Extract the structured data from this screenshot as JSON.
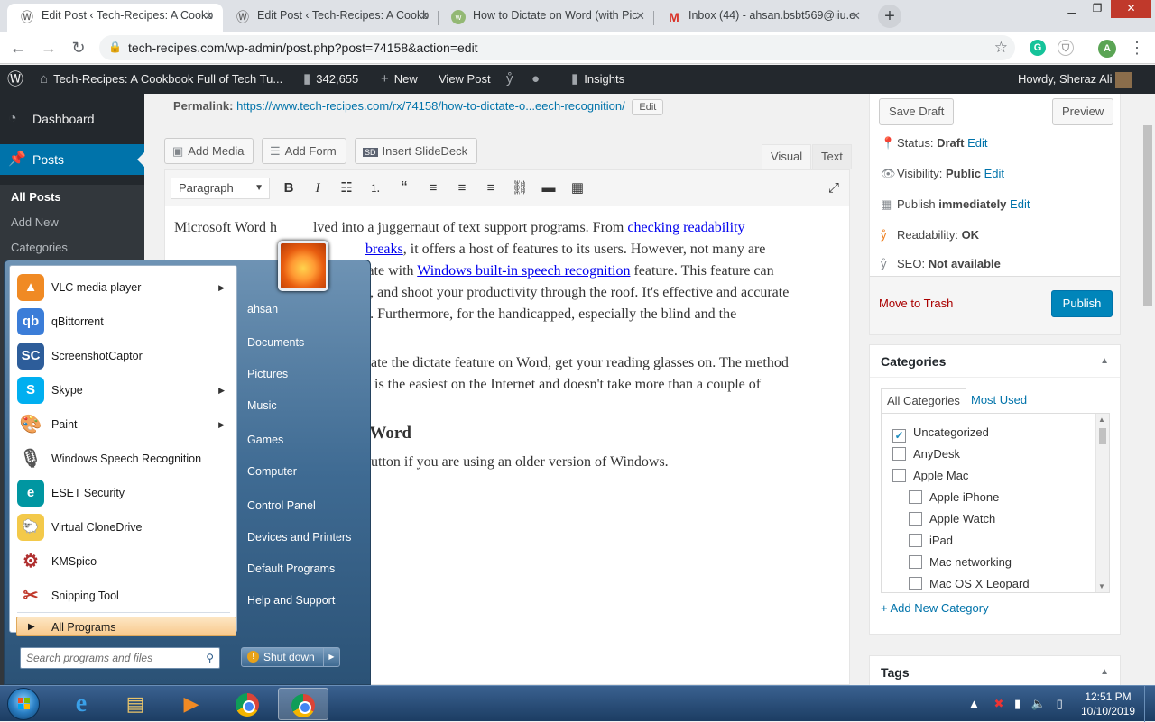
{
  "browser": {
    "tabs": [
      {
        "title": "Edit Post ‹ Tech-Recipes: A Cookb",
        "icon": "wordpress-icon",
        "active": true
      },
      {
        "title": "Edit Post ‹ Tech-Recipes: A Cookb",
        "icon": "wordpress-icon",
        "active": false
      },
      {
        "title": "How to Dictate on Word (with Pic",
        "icon": "wikihow-icon",
        "active": false
      },
      {
        "title": "Inbox (44) - ahsan.bsbt569@iiu.e",
        "icon": "gmail-icon",
        "active": false
      }
    ],
    "new_tab": "+",
    "url": "tech-recipes.com/wp-admin/post.php?post=74158&action=edit",
    "profile_initial": "A",
    "grammarly": "G"
  },
  "adminbar": {
    "site_name": "Tech-Recipes: A Cookbook Full of Tech Tu...",
    "comments": "342,655",
    "new": "New",
    "view_post": "View Post",
    "insights": "Insights",
    "howdy": "Howdy, Sheraz Ali"
  },
  "sidebar": {
    "dashboard": "Dashboard",
    "posts": "Posts",
    "submenu": [
      "All Posts",
      "Add New",
      "Categories"
    ]
  },
  "editor": {
    "permalink_label": "Permalink:",
    "permalink_url": "https://www.tech-recipes.com/rx/74158/how-to-dictate-o...eech-recognition/",
    "permalink_edit": "Edit",
    "add_media": "Add Media",
    "add_form": "Add Form",
    "insert_slidedeck": "Insert SlideDeck",
    "tab_visual": "Visual",
    "tab_text": "Text",
    "format_select": "Paragraph",
    "p1_start": "Microsoft Word h",
    "p1_mid1": "lved into a juggernaut of text support programs. From ",
    "p1_link1": "checking readability ",
    "p1_line2a": "",
    "p1_link2": "breaks",
    "p1_line2b": ", it offers a host of features to its users. However, not many are",
    "p1_line3a": "tate with ",
    "p1_link3": "Windows built-in speech recognition",
    "p1_line3b": " feature.  This feature can",
    "p1_line4": "e, and shoot your productivity through the roof. It's effective and accurate",
    "p1_line5": "e. Furthermore, for the handicapped, especially the blind and the",
    "p2_line1": "vate the dictate feature on Word, get your reading glasses on. The method",
    "p2_line2": "y is the easiest on the Internet and doesn't take more than a couple of",
    "h3": "on Word",
    "p3": "button if you are using an older version of Windows."
  },
  "publish": {
    "save_draft": "Save Draft",
    "preview": "Preview",
    "status_label": "Status:",
    "status_value": "Draft",
    "visibility_label": "Visibility:",
    "visibility_value": "Public",
    "publish_label": "Publish",
    "publish_value": "immediately",
    "edit": "Edit",
    "readability_label": "Readability:",
    "readability_value": "OK",
    "seo_label": "SEO:",
    "seo_value": "Not available",
    "trash": "Move to Trash",
    "publish_button": "Publish"
  },
  "categories": {
    "title": "Categories",
    "tab_all": "All Categories",
    "tab_used": "Most Used",
    "items": [
      {
        "label": "Uncategorized",
        "checked": true,
        "indent": 0
      },
      {
        "label": "AnyDesk",
        "checked": false,
        "indent": 0
      },
      {
        "label": "Apple Mac",
        "checked": false,
        "indent": 0
      },
      {
        "label": "Apple iPhone",
        "checked": false,
        "indent": 1
      },
      {
        "label": "Apple Watch",
        "checked": false,
        "indent": 1
      },
      {
        "label": "iPad",
        "checked": false,
        "indent": 1
      },
      {
        "label": "Mac networking",
        "checked": false,
        "indent": 1
      },
      {
        "label": "Mac OS X Leopard",
        "checked": false,
        "indent": 1
      }
    ],
    "add_new": "+ Add New Category"
  },
  "tags": {
    "title": "Tags"
  },
  "startmenu": {
    "programs": [
      {
        "label": "VLC media player",
        "icon": "vlc-icon",
        "arrow": true
      },
      {
        "label": "qBittorrent",
        "icon": "qbittorrent-icon",
        "arrow": false
      },
      {
        "label": "ScreenshotCaptor",
        "icon": "screenshotcaptor-icon",
        "arrow": false
      },
      {
        "label": "Skype",
        "icon": "skype-icon",
        "arrow": true
      },
      {
        "label": "Paint",
        "icon": "paint-icon",
        "arrow": true
      },
      {
        "label": "Windows Speech Recognition",
        "icon": "microphone-icon",
        "arrow": false
      },
      {
        "label": "ESET Security",
        "icon": "eset-icon",
        "arrow": false
      },
      {
        "label": "Virtual CloneDrive",
        "icon": "clonedrive-icon",
        "arrow": false
      },
      {
        "label": "KMSpico",
        "icon": "kmspico-icon",
        "arrow": false
      },
      {
        "label": "Snipping Tool",
        "icon": "scissors-icon",
        "arrow": false
      }
    ],
    "all_programs": "All Programs",
    "search_placeholder": "Search programs and files",
    "right_items": [
      "ahsan",
      "Documents",
      "Pictures",
      "Music",
      "Games",
      "Computer",
      "Control Panel",
      "Devices and Printers",
      "Default Programs",
      "Help and Support"
    ],
    "shutdown": "Shut down"
  },
  "taskbar": {
    "time": "12:51 PM",
    "date": "10/10/2019"
  }
}
